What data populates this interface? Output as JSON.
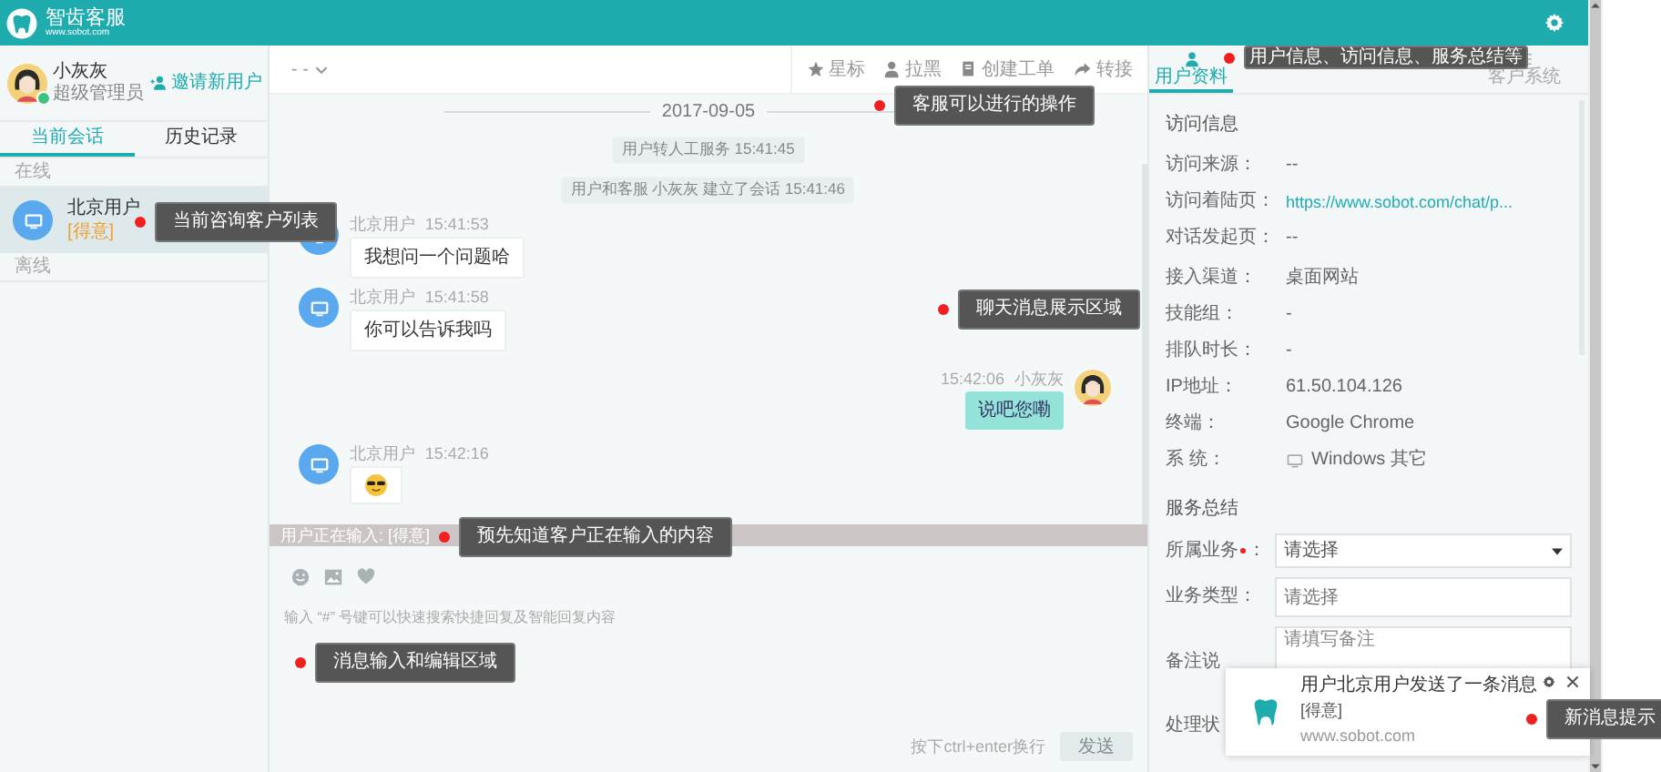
{
  "header": {
    "title": "智齿客服",
    "subtitle": "www.sobot.com"
  },
  "agent": {
    "name": "小灰灰",
    "role": "超级管理员",
    "invite_button": "邀请新用户"
  },
  "left_tabs": [
    {
      "label": "当前会话",
      "selected": true
    },
    {
      "label": "历史记录",
      "selected": false
    }
  ],
  "session_groups": [
    {
      "title": "在线",
      "items": [
        {
          "name": "北京用户",
          "tag": "[得意]",
          "selected": true
        }
      ]
    },
    {
      "title": "离线"
    }
  ],
  "chat_toolbar": {
    "dropdown": "- -",
    "actions": [
      {
        "label": "星标"
      },
      {
        "label": "拉黑"
      },
      {
        "label": "创建工单"
      },
      {
        "label": "转接"
      }
    ]
  },
  "chat": {
    "date": "2017-09-05",
    "messages": [
      {
        "kind": "system",
        "text": "用户转人工服务 15:41:45"
      },
      {
        "kind": "system",
        "text": "用户和客服 小灰灰 建立了会话 15:41:46"
      },
      {
        "kind": "incoming",
        "sender": "北京用户",
        "time": "15:41:53",
        "text": "我想问一个问题哈"
      },
      {
        "kind": "incoming",
        "sender": "北京用户",
        "time": "15:41:58",
        "text": "你可以告诉我吗"
      },
      {
        "kind": "outgoing",
        "sender": "小灰灰",
        "time": "15:42:06",
        "text": "说吧您嘞"
      },
      {
        "kind": "emoji",
        "sender": "北京用户",
        "time": "15:42:16"
      }
    ]
  },
  "typing_bar": "用户正在输入: [得意]",
  "composer": {
    "hint": "输入 “#” 号键可以快速搜索快捷回复及智能回复内容",
    "shortcut": "按下ctrl+enter换行",
    "send_button": "发送",
    "send_disabled": true
  },
  "right_tabs": [
    {
      "label": "用户资料",
      "selected": true
    },
    {
      "label": "客户系统",
      "selected": false
    }
  ],
  "visit_info": {
    "title": "访问信息",
    "rows": [
      {
        "kind": "text",
        "label": "访问来源：",
        "value": "--"
      },
      {
        "kind": "link",
        "label": "访问着陆页：",
        "value": "https://www.sobot.com/chat/p..."
      },
      {
        "kind": "text",
        "label": "对话发起页：",
        "value": "--"
      },
      {
        "kind": "text",
        "label": "接入渠道：",
        "value": "桌面网站"
      },
      {
        "kind": "text",
        "label": "技能组：",
        "value": "-"
      },
      {
        "kind": "text",
        "label": "排队时长：",
        "value": "-"
      },
      {
        "kind": "text",
        "label": "IP地址：",
        "value": "61.50.104.126"
      },
      {
        "kind": "text",
        "label": "终端：",
        "value": "Google Chrome"
      },
      {
        "kind": "os",
        "label": "系 统：",
        "value": "Windows 其它"
      }
    ]
  },
  "service_summary": {
    "title": "服务总结",
    "fields": [
      {
        "kind": "select",
        "label": "所属业务",
        "required": true,
        "suffix": "：",
        "value": "请选择"
      },
      {
        "kind": "input",
        "label": "业务类型：",
        "placeholder": "请选择"
      },
      {
        "kind": "textarea",
        "label": "备注说",
        "placeholder": "请填写备注"
      },
      {
        "kind": "hidden",
        "label": "处理状"
      }
    ]
  },
  "notification": {
    "title": "用户北京用户发送了一条消息",
    "message": "[得意]",
    "site": "www.sobot.com"
  },
  "annotations": [
    {
      "text": "当前咨询客户列表"
    },
    {
      "text": "客服可以进行的操作"
    },
    {
      "text": "聊天消息展示区域"
    },
    {
      "text": "预先知道客户正在输入的内容"
    },
    {
      "text": "消息输入和编辑区域"
    },
    {
      "text": "用户信息、访问信息、服务总结等"
    },
    {
      "text": "新消息提示"
    }
  ]
}
